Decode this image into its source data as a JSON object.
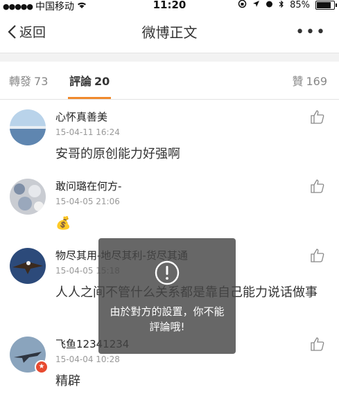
{
  "status_bar": {
    "signal_dots": "●●●●●",
    "carrier": "中国移动",
    "time": "11:20",
    "battery_percent": "85%",
    "battery_level": 0.85
  },
  "nav": {
    "back_label": "返回",
    "title": "微博正文",
    "more_label": "•••"
  },
  "tabs": {
    "repost": {
      "label": "轉發",
      "count": "73"
    },
    "comment": {
      "label": "評論",
      "count": "20"
    },
    "like": {
      "label": "贊",
      "count": "169"
    },
    "accent": "#f08a2c"
  },
  "comments": [
    {
      "user": "心怀真善美",
      "time": "15-04-11 16:24",
      "text": "安哥的原创能力好强啊"
    },
    {
      "user": "敢问璐在何方-",
      "time": "15-04-05 21:06",
      "text": "💰"
    },
    {
      "user": "物尽其用-地尽其利-货尽其通",
      "time": "15-04-05 15:18",
      "text": "人人之间不管什么关系都是靠自己能力说话做事"
    },
    {
      "user": "飞鱼12341234",
      "time": "15-04-04 10:28",
      "text": "精辟"
    }
  ],
  "toast": {
    "icon": "exclamation-circle-icon",
    "message": "由於對方的設置，你不能評論哦!"
  },
  "icons": {
    "back": "chevron-left-icon",
    "like": "thumbs-up-icon",
    "wifi": "wifi-icon",
    "location": "location-arrow-icon",
    "bluetooth": "bluetooth-icon",
    "battery": "battery-icon"
  }
}
